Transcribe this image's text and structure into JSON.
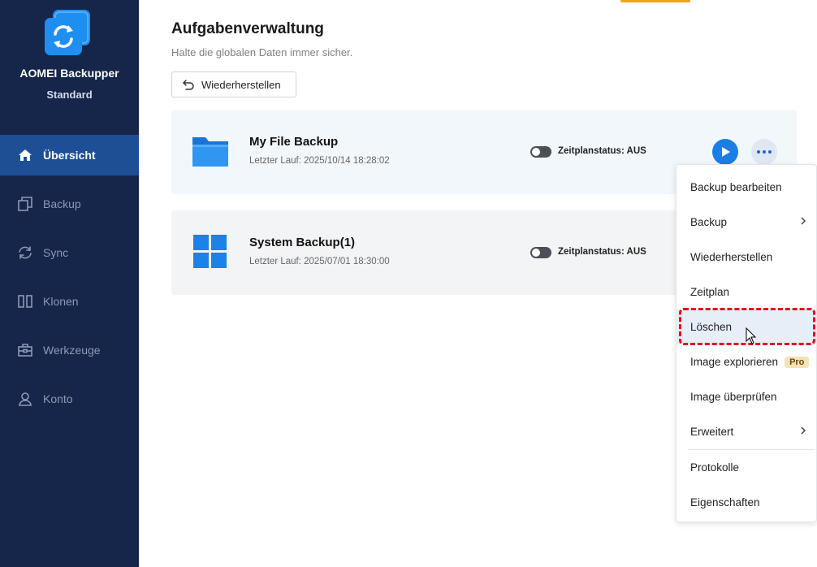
{
  "app": {
    "name": "AOMEI Backupper",
    "edition": "Standard"
  },
  "sidebar": {
    "items": [
      {
        "label": "Übersicht",
        "icon": "home-icon",
        "active": true
      },
      {
        "label": "Backup",
        "icon": "copy-icon",
        "active": false
      },
      {
        "label": "Sync",
        "icon": "sync-icon",
        "active": false
      },
      {
        "label": "Klonen",
        "icon": "clone-icon",
        "active": false
      },
      {
        "label": "Werkzeuge",
        "icon": "toolbox-icon",
        "active": false
      },
      {
        "label": "Konto",
        "icon": "user-icon",
        "active": false
      }
    ]
  },
  "main": {
    "title": "Aufgabenverwaltung",
    "subtitle": "Halte die globalen Daten immer sicher.",
    "restore_label": "Wiederherstellen"
  },
  "tasks": [
    {
      "name": "My File Backup",
      "last_run": "Letzter Lauf: 2025/10/14 18:28:02",
      "schedule_status": "Zeitplanstatus: AUS",
      "icon": "folder-icon"
    },
    {
      "name": "System Backup(1)",
      "last_run": "Letzter Lauf: 2025/07/01 18:30:00",
      "schedule_status": "Zeitplanstatus: AUS",
      "icon": "windows-icon"
    }
  ],
  "context_menu": {
    "items": [
      {
        "label": "Backup bearbeiten"
      },
      {
        "label": "Backup",
        "submenu": true
      },
      {
        "label": "Wiederherstellen"
      },
      {
        "label": "Zeitplan"
      },
      {
        "label": "Löschen",
        "hovered": true
      },
      {
        "label": "Image explorieren",
        "badge": "Pro"
      },
      {
        "label": "Image überprüfen"
      },
      {
        "label": "Erweitert",
        "submenu": true
      },
      {
        "label": "Protokolle"
      },
      {
        "label": "Eigenschaften"
      }
    ]
  },
  "colors": {
    "sidebar_bg": "#16254a",
    "sidebar_active": "#1e4f95",
    "accent_blue": "#1a7ee6",
    "highlight_red": "#e0101e",
    "top_accent": "#f7a21b"
  }
}
